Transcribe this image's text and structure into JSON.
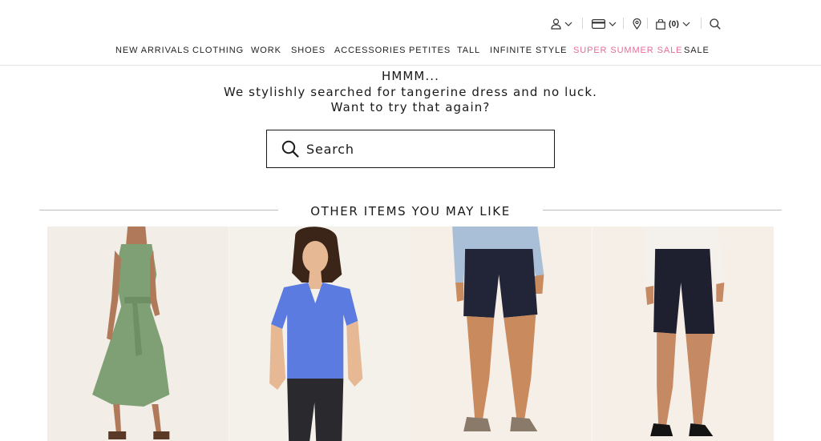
{
  "header": {
    "account_icon": "user-icon",
    "wallet_icon": "credit-card-icon",
    "store_icon": "map-pin-icon",
    "bag_icon": "shopping-bag-icon",
    "bag_count": "(0)",
    "search_icon": "search-icon"
  },
  "nav": {
    "items": [
      {
        "label": "NEW ARRIVALS"
      },
      {
        "label": "CLOTHING"
      },
      {
        "label": "WORK"
      },
      {
        "label": "SHOES"
      },
      {
        "label": "ACCESSORIES"
      },
      {
        "label": "PETITES"
      },
      {
        "label": "TALL"
      },
      {
        "label": "INFINITE STYLE"
      },
      {
        "label": "SUPER SUMMER SALE"
      },
      {
        "label": "SALE"
      }
    ],
    "accent_color": "#e86b9a"
  },
  "no_results": {
    "line1": "HMMM...",
    "line2": "We stylishly searched for tangerine dress and no luck.",
    "line3": "Want to try that again?"
  },
  "search": {
    "placeholder": "Search",
    "value": ""
  },
  "recommendations": {
    "title": "OTHER ITEMS YOU MAY LIKE",
    "products": [
      {
        "image": "green-sleeveless-belted-midi-dress"
      },
      {
        "image": "blue-v-neck-tee-with-dark-jeans"
      },
      {
        "image": "navy-shorts-with-light-blue-shirt"
      },
      {
        "image": "navy-shorts-with-white-top"
      }
    ]
  }
}
